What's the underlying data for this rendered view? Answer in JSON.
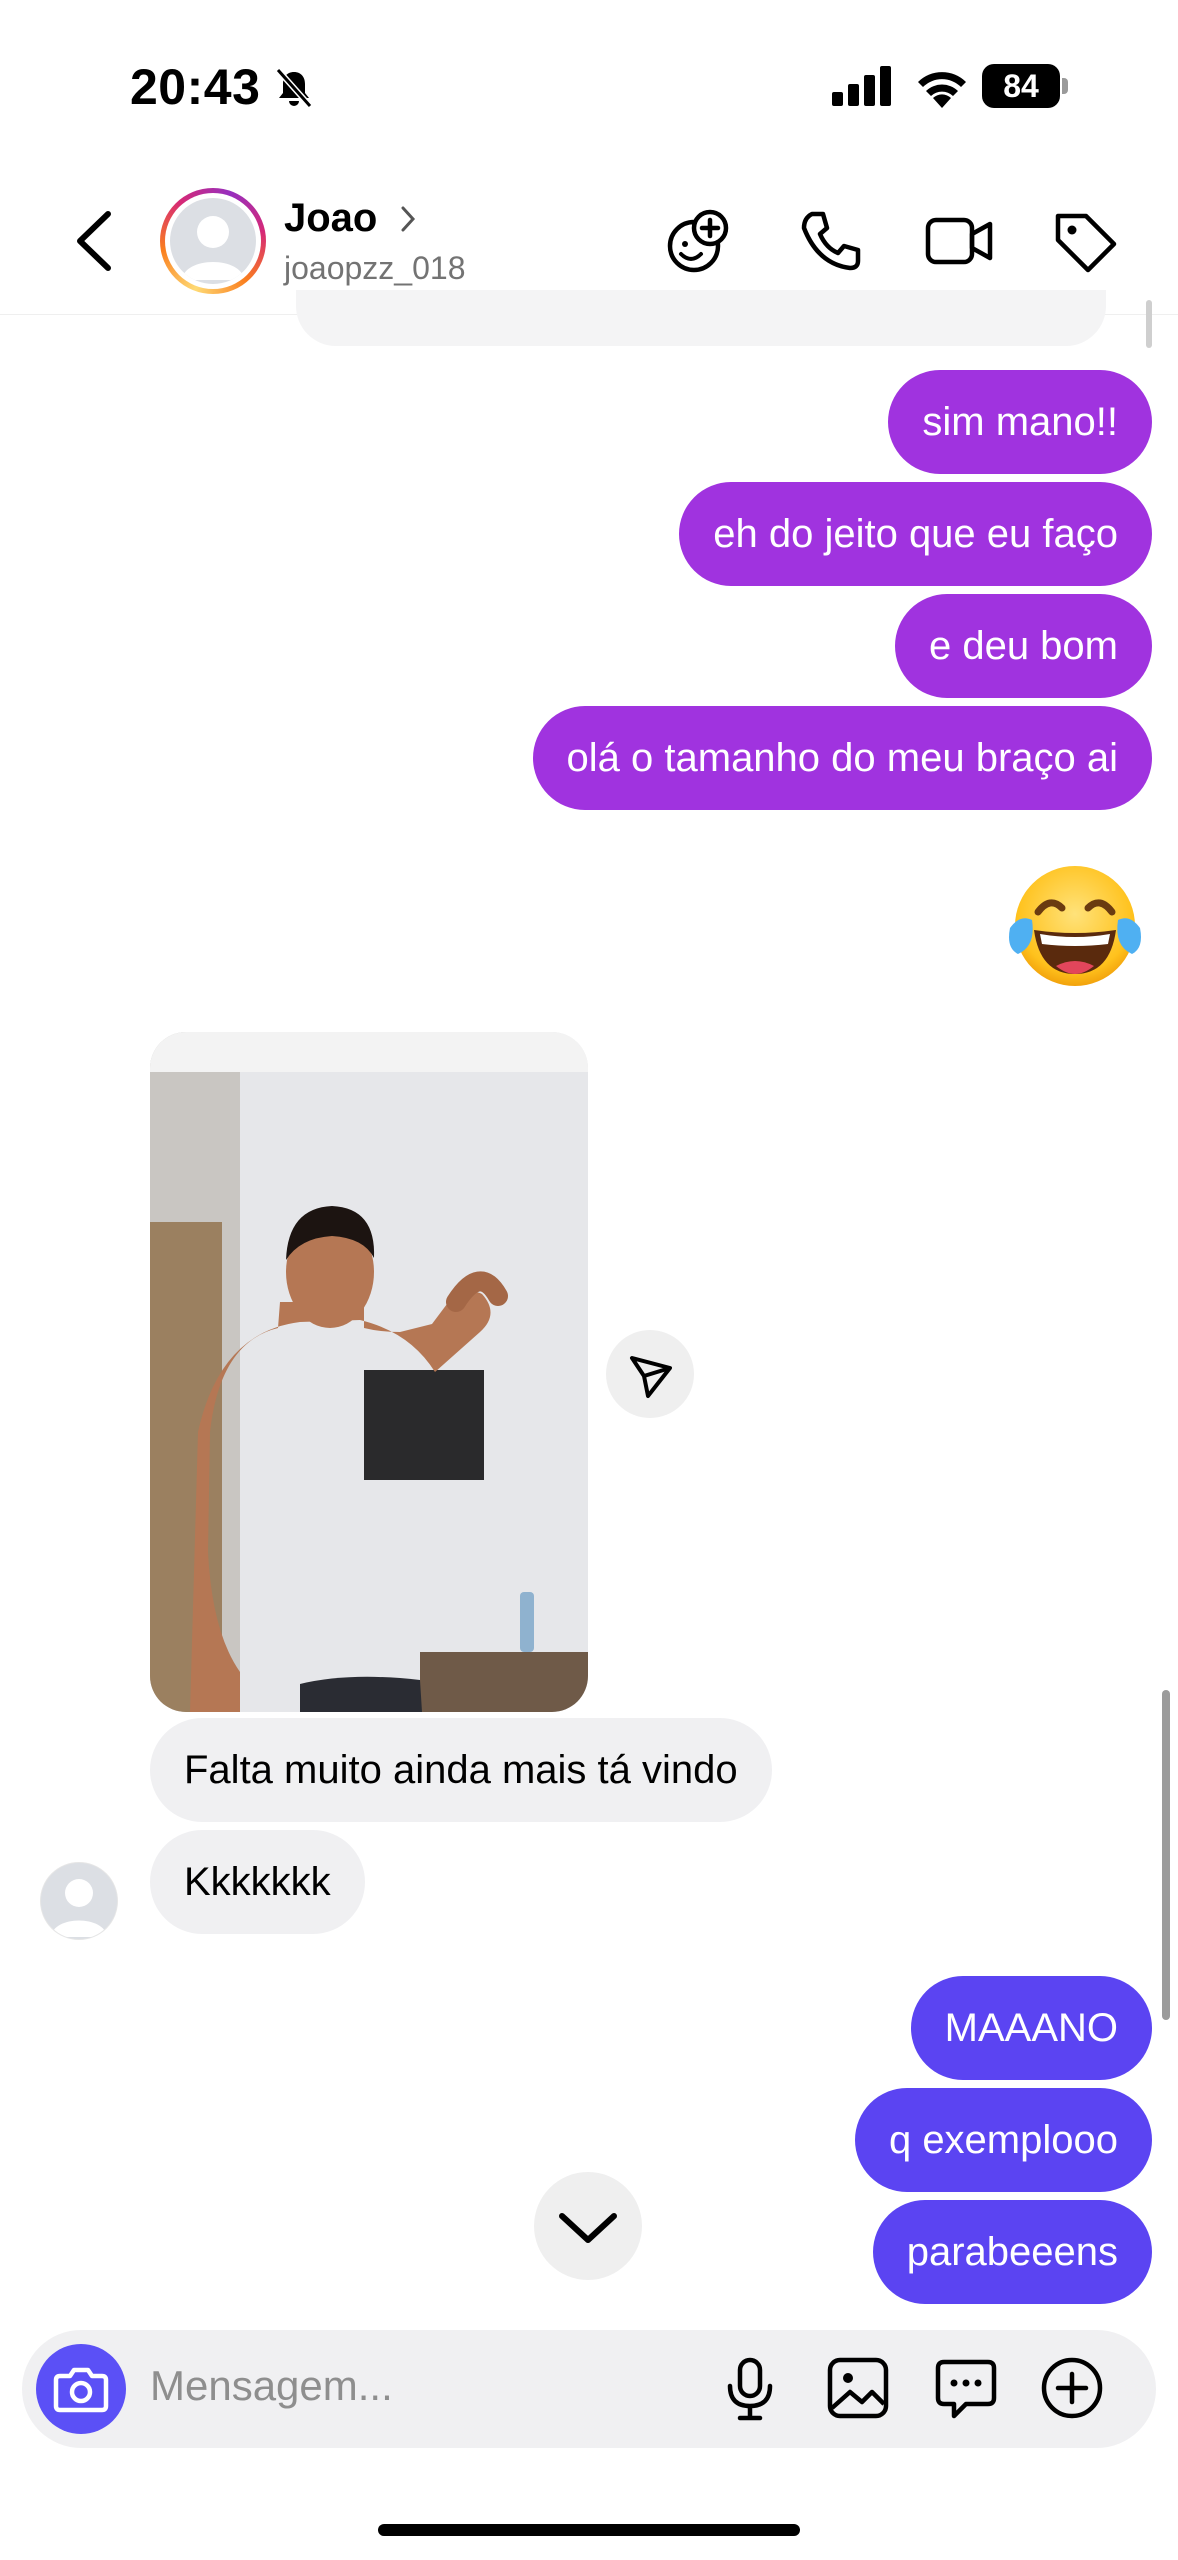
{
  "status_bar": {
    "time": "20:43",
    "battery": "84",
    "icons": [
      "bell-slash-icon",
      "cellular-signal-icon",
      "wifi-icon",
      "battery-icon"
    ]
  },
  "header": {
    "contact_name": "Joao",
    "username": "joaopzz_018",
    "icons": [
      "back-icon",
      "chevron-right-icon",
      "sticker-add-icon",
      "phone-icon",
      "video-icon",
      "tag-icon"
    ]
  },
  "messages": [
    {
      "direction": "outgoing",
      "text": "sim mano!!"
    },
    {
      "direction": "outgoing",
      "text": "eh do jeito que eu faço"
    },
    {
      "direction": "outgoing",
      "text": "e deu bom"
    },
    {
      "direction": "outgoing",
      "text": "olá o tamanho do meu braço ai"
    },
    {
      "direction": "outgoing",
      "text": "😂",
      "type": "emoji"
    },
    {
      "direction": "incoming",
      "type": "photo"
    },
    {
      "direction": "incoming",
      "text": "Falta muito ainda mais tá vindo"
    },
    {
      "direction": "incoming",
      "text": "Kkkkkkk"
    },
    {
      "direction": "outgoing",
      "text": "MAAANO"
    },
    {
      "direction": "outgoing",
      "text": "q exemplooo"
    },
    {
      "direction": "outgoing",
      "text": "parabeeens"
    }
  ],
  "composer": {
    "placeholder": "Mensagem...",
    "icons": [
      "camera-icon",
      "microphone-icon",
      "gallery-icon",
      "sticker-chat-icon",
      "plus-circle-icon"
    ]
  },
  "colors": {
    "outgoing_purple": "#a033df",
    "outgoing_indigo": "#5b44f2",
    "incoming_bubble": "#f0f0f2",
    "camera_button": "#5b50f6",
    "secondary_text": "#737373"
  }
}
